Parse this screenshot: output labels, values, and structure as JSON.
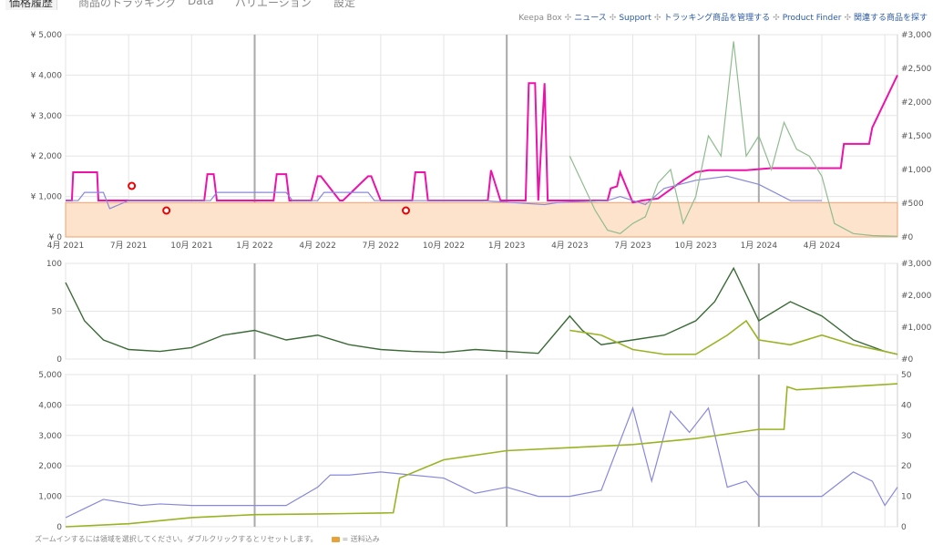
{
  "tabs": [
    "価格履歴",
    "商品のトラッキング",
    "Data",
    "バリエーション",
    "設定"
  ],
  "links": {
    "keepa_box": "Keepa Box",
    "items": [
      "ニュース",
      "Support",
      "トラッキング商品を管理する",
      "Product Finder",
      "関連する商品を探す"
    ]
  },
  "footer": {
    "hint": "ズームインするには領域を選択してください。ダブルクリックするとリセットします。",
    "shipping_legend": "= 送料込み"
  },
  "colors": {
    "new": "#ee11aa",
    "amazon_fill": "#fde3cc",
    "amazon_line": "#f0a070",
    "used": "#8888dd",
    "sales_rank": "#8fbc8f",
    "rating": "#3a6b35",
    "count": "#9ab322",
    "offers": "#8888dd",
    "grid": "#e5e5e5",
    "year_line": "#aaaaaa"
  },
  "chart_data": [
    {
      "type": "line",
      "x_ticks": [
        "4月 2021",
        "7月 2021",
        "10月 2021",
        "1月 2022",
        "4月 2022",
        "7月 2022",
        "10月 2022",
        "1月 2023",
        "4月 2023",
        "7月 2023",
        "10月 2023",
        "1月 2024",
        "4月 2024"
      ],
      "y_left_ticks": [
        "¥ 0",
        "¥ 1,000",
        "¥ 2,000",
        "¥ 3,000",
        "¥ 4,000",
        "¥ 5,000"
      ],
      "y_right_ticks": [
        "#0",
        "#500",
        "#1,000",
        "#1,500",
        "#2,000",
        "#2,500",
        "#3,000"
      ],
      "ylim_left": [
        0,
        5000
      ],
      "ylim_right": [
        0,
        3000
      ],
      "series": [
        {
          "key": "amazon",
          "x": [
            0,
            1,
            1.05,
            1.7,
            1.75,
            12.3,
            12.32,
            13.2
          ],
          "values": [
            850,
            850,
            850,
            850,
            850,
            850,
            850,
            850
          ]
        },
        {
          "key": "new",
          "x": [
            0,
            0.1,
            0.12,
            0.5,
            0.52,
            0.68,
            0.7,
            1.0,
            1.02,
            2.2,
            2.25,
            2.35,
            2.4,
            3.3,
            3.35,
            3.5,
            3.55,
            3.9,
            4.0,
            4.05,
            4.35,
            4.4,
            4.8,
            4.85,
            5.0,
            5.5,
            5.55,
            5.7,
            5.75,
            6.7,
            6.75,
            6.9,
            7.3,
            7.35,
            7.45,
            7.5,
            7.6,
            7.65,
            8.3,
            8.6,
            8.65,
            8.75,
            8.8,
            9.0,
            9.15,
            9.4,
            9.8,
            10.0,
            10.2,
            10.5,
            10.8,
            11.2,
            11.6,
            12.0,
            12.3,
            12.35,
            12.75,
            12.8,
            13.2
          ],
          "values": [
            900,
            900,
            1600,
            1600,
            900,
            900,
            900,
            900,
            900,
            900,
            1550,
            1550,
            900,
            900,
            1550,
            1550,
            900,
            900,
            1500,
            1500,
            900,
            900,
            1500,
            1500,
            900,
            900,
            1600,
            1600,
            900,
            900,
            1650,
            900,
            900,
            3800,
            3800,
            900,
            3800,
            900,
            900,
            900,
            1200,
            1250,
            1600,
            850,
            900,
            950,
            1400,
            1600,
            1650,
            1650,
            1650,
            1700,
            1700,
            1700,
            1700,
            2300,
            2300,
            2700,
            4000
          ]
        },
        {
          "key": "used",
          "x": [
            0,
            0.2,
            0.3,
            0.6,
            0.7,
            1.0,
            1.1,
            2.3,
            2.4,
            3.5,
            3.6,
            4.0,
            4.1,
            4.8,
            4.9,
            6.5,
            6.6,
            7.6,
            7.8,
            8.6,
            8.8,
            9.2,
            9.5,
            10.0,
            10.5,
            11.0,
            11.5,
            12.0
          ],
          "values": [
            900,
            900,
            1100,
            1100,
            700,
            900,
            900,
            900,
            1100,
            1100,
            900,
            900,
            1100,
            1100,
            900,
            900,
            900,
            800,
            850,
            900,
            1000,
            800,
            1200,
            1400,
            1500,
            1300,
            900,
            900
          ]
        },
        {
          "key": "sales_rank",
          "x": [
            8.0,
            8.2,
            8.4,
            8.6,
            8.8,
            9.0,
            9.2,
            9.4,
            9.6,
            9.8,
            10.0,
            10.2,
            10.4,
            10.6,
            10.8,
            11.0,
            11.2,
            11.4,
            11.6,
            11.8,
            12.0,
            12.2,
            12.5,
            12.8,
            13.2
          ],
          "values": [
            1200,
            800,
            400,
            100,
            50,
            200,
            300,
            800,
            1000,
            200,
            600,
            1500,
            1200,
            2900,
            1200,
            1500,
            1000,
            1700,
            1300,
            1200,
            900,
            200,
            50,
            20,
            10
          ]
        }
      ]
    },
    {
      "type": "line",
      "x_ticks": [],
      "y_left_ticks": [
        "0",
        "50",
        "100"
      ],
      "y_right_ticks": [
        "#0",
        "#1,000",
        "#2,000",
        "#3,000"
      ],
      "ylim_left": [
        0,
        100
      ],
      "ylim_right": [
        0,
        3000
      ],
      "series": [
        {
          "key": "rating",
          "x": [
            0,
            0.3,
            0.6,
            1.0,
            1.5,
            2.0,
            2.5,
            3.0,
            3.5,
            4.0,
            4.5,
            5.0,
            5.5,
            6.0,
            6.5,
            7.0,
            7.5,
            8.0,
            8.2,
            8.5,
            9.0,
            9.5,
            10.0,
            10.3,
            10.6,
            11.0,
            11.5,
            12.0,
            12.5,
            13.0,
            13.2
          ],
          "values": [
            80,
            40,
            20,
            10,
            8,
            12,
            25,
            30,
            20,
            25,
            15,
            10,
            8,
            7,
            10,
            8,
            6,
            45,
            30,
            15,
            20,
            25,
            40,
            60,
            95,
            40,
            60,
            45,
            20,
            8,
            5
          ]
        },
        {
          "key": "count",
          "x": [
            8.0,
            8.5,
            9.0,
            9.5,
            10.0,
            10.5,
            10.8,
            11.0,
            11.5,
            12.0,
            12.5,
            13.0,
            13.2
          ],
          "values": [
            30,
            25,
            10,
            5,
            5,
            25,
            40,
            20,
            15,
            25,
            15,
            8,
            5
          ]
        }
      ]
    },
    {
      "type": "line",
      "x_ticks": [],
      "y_left_ticks": [
        "0",
        "1,000",
        "2,000",
        "3,000",
        "4,000",
        "5,000"
      ],
      "y_right_ticks": [
        "0",
        "10",
        "20",
        "30",
        "40",
        "50"
      ],
      "ylim_left": [
        0,
        5000
      ],
      "ylim_right": [
        0,
        50
      ],
      "series": [
        {
          "key": "offers",
          "x": [
            0,
            0.3,
            0.6,
            0.9,
            1.2,
            1.5,
            2.0,
            2.5,
            3.0,
            3.5,
            4.0,
            4.2,
            4.5,
            5.0,
            5.5,
            6.0,
            6.5,
            7.0,
            7.5,
            8.0,
            8.5,
            9.0,
            9.3,
            9.6,
            9.9,
            10.2,
            10.5,
            10.8,
            11.0,
            11.5,
            12.0,
            12.5,
            12.8,
            13.0,
            13.2
          ],
          "values": [
            300,
            600,
            900,
            800,
            700,
            750,
            700,
            700,
            700,
            700,
            1300,
            1700,
            1700,
            1800,
            1700,
            1600,
            1100,
            1300,
            1000,
            1000,
            1200,
            3900,
            1500,
            3800,
            3100,
            3900,
            1300,
            1500,
            1000,
            1000,
            1000,
            1800,
            1500,
            700,
            1300
          ]
        },
        {
          "key": "count",
          "x": [
            0,
            1,
            2,
            3,
            4,
            5,
            5.2,
            5.3,
            6,
            7,
            8,
            9,
            10,
            11,
            11.4,
            11.45,
            11.6,
            13.2
          ],
          "values": [
            0,
            1,
            3,
            4,
            4.2,
            4.5,
            4.6,
            16,
            22,
            25,
            26,
            27,
            29,
            32,
            32,
            46,
            45,
            47
          ]
        }
      ]
    }
  ]
}
